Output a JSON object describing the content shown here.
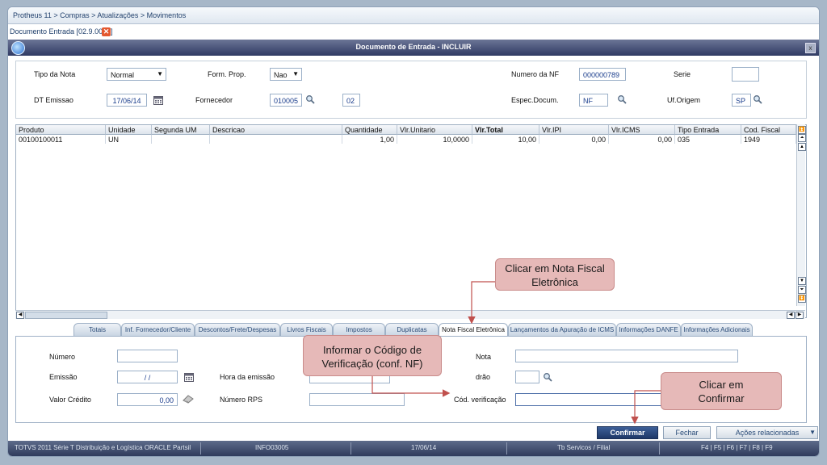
{
  "breadcrumb": "Protheus 11 > Compras  > Atualizações > Movimentos",
  "document_tab": {
    "label": "Documento Entrada [02.9.0002]",
    "close": "✕"
  },
  "window": {
    "title": "Documento de Entrada - INCLUIR",
    "close": "x"
  },
  "header": {
    "tipo_nota_label": "Tipo da Nota",
    "tipo_nota_value": "Normal",
    "form_prop_label": "Form. Prop.",
    "form_prop_value": "Nao",
    "numero_nf_label": "Numero da NF",
    "numero_nf_value": "000000789",
    "serie_label": "Serie",
    "serie_value": "",
    "dt_emissao_label": "DT Emissao",
    "dt_emissao_value": "17/06/14",
    "fornecedor_label": "Fornecedor",
    "fornecedor_value": "010005",
    "loja_value": "02",
    "espec_label": "Espec.Docum.",
    "espec_value": "NF",
    "uf_label": "Uf.Origem",
    "uf_value": "SP"
  },
  "grid": {
    "columns": [
      "Produto",
      "Unidade",
      "Segunda UM",
      "Descricao",
      "Quantidade",
      "Vlr.Unitario",
      "Vlr.Total",
      "Vlr.IPI",
      "Vlr.ICMS",
      "Tipo Entrada",
      "Cod. Fiscal"
    ],
    "rows": [
      [
        "00100100011",
        "UN",
        "",
        "",
        "1,00",
        "10,0000",
        "10,00",
        "0,00",
        "0,00",
        "035",
        "1949"
      ]
    ]
  },
  "tabs": [
    "Totais",
    "Inf. Fornecedor/Cliente",
    "Descontos/Frete/Despesas",
    "Livros Fiscais",
    "Impostos",
    "Duplicatas",
    "Nota Fiscal Eletrônica",
    "Lançamentos da Apuração de ICMS",
    "Informações DANFE",
    "Informações Adicionais"
  ],
  "active_tab": "Nota Fiscal Eletrônica",
  "nfe": {
    "numero_label": "Número",
    "numero_value": "",
    "emissao_label": "Emissão",
    "emissao_value": "/ /",
    "hora_label": "Hora da emissão",
    "valor_credito_label": "Valor Crédito",
    "valor_credito_value": "0,00",
    "numero_rps_label": "Número RPS",
    "nota_label": "Nota",
    "padrao_label": "drão",
    "cod_verif_label": "Cód. verificação",
    "cod_verif_value": ""
  },
  "callouts": {
    "nfe_tab": "Clicar em  Nota Fiscal Eletrônica",
    "cod_verif": "Informar o Código de Verificação (conf. NF)",
    "confirmar": "Clicar em Confirmar"
  },
  "buttons": {
    "confirmar": "Confirmar",
    "fechar": "Fechar",
    "acoes": "Ações relacionadas"
  },
  "status_bar": {
    "system": "TOTVS 2011 Série T Distribuição e Logística ORACLE Partsil",
    "user": "INFO03005",
    "date": "17/06/14",
    "branch": "Tb Servicos / Filial",
    "keys": "F4 | F5 | F6 | F7 | F8 | F9"
  },
  "colors": {
    "accent": "#2f3a63",
    "callout": "#e6b9b8",
    "arrow": "#c0504d"
  },
  "icons": [
    "search-icon",
    "calendar-icon",
    "eraser-icon",
    "app-logo-icon"
  ]
}
